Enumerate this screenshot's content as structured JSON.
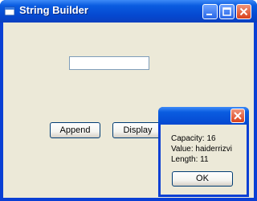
{
  "window": {
    "title": "String Builder",
    "controls": {
      "minimize_icon": "minimize-icon",
      "maximize_icon": "maximize-icon",
      "close_icon": "close-icon"
    }
  },
  "form": {
    "textbox_value": "",
    "append_label": "Append",
    "display_label": "Display"
  },
  "message_box": {
    "title": "",
    "lines": [
      "Capacity: 16",
      "Value: haiderrizvi",
      "Length: 11"
    ],
    "ok_label": "OK"
  },
  "colors": {
    "titlebar": "#0548d0",
    "client": "#ece9d8",
    "close_button": "#d8411c"
  }
}
